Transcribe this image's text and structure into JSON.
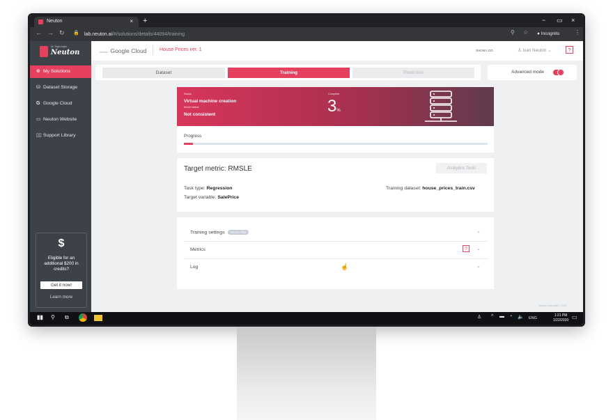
{
  "browser": {
    "tab_title": "Neuton",
    "new_tab": "+",
    "tab_close": "×",
    "url_host": "lab.neuton.ai",
    "url_path": "/#/solutions/details/44094/training",
    "profile_label": "Incognito",
    "window_controls": [
      "−",
      "▭",
      "×"
    ]
  },
  "sidebar": {
    "logo_text": "Neuton",
    "logo_tagline": "An Tegin Ingiin",
    "items": [
      {
        "label": "My Solutions",
        "icon": "solutions-icon",
        "active": true
      },
      {
        "label": "Dataset Storage",
        "icon": "storage-icon",
        "active": false
      },
      {
        "label": "Google Cloud",
        "icon": "google-icon",
        "active": false
      },
      {
        "label": "Neuton Website",
        "icon": "monitor-icon",
        "active": false
      },
      {
        "label": "Support Library",
        "icon": "book-icon",
        "active": false
      }
    ],
    "promo": {
      "symbol": "$",
      "text": "Eligible for an additional $200 in credits?",
      "button": "Get it now!",
      "link": "Learn more"
    }
  },
  "header": {
    "brand_prefix": "neuron",
    "brand": "Google Cloud",
    "project": "House Prices ver. 1",
    "schedule": "SHOW LOG",
    "user": "Ivan Neuton",
    "help": "?"
  },
  "steps": [
    {
      "label": "Dataset",
      "state": "done"
    },
    {
      "label": "Training",
      "state": "active"
    },
    {
      "label": "Prediction",
      "state": "pending"
    }
  ],
  "advanced_mode": {
    "label": "Advanced mode",
    "on": true
  },
  "status": {
    "status_label": "Status",
    "status_value": "Virtual machine creation",
    "model_label": "Model status",
    "model_value": "Not consistent",
    "complete_label": "Complete",
    "complete_value": "3",
    "complete_unit": "%",
    "progress_label": "Progress",
    "progress_fraction": 0.03
  },
  "target": {
    "metric_label": "Target metric:",
    "metric_value": "RMSLE",
    "analytics_button": "Analytics Tools",
    "task_type_label": "Task type:",
    "task_type_value": "Regression",
    "target_var_label": "Target variable:",
    "target_var_value": "SalePrice",
    "dataset_label": "Training dataset:",
    "dataset_value": "house_prices_train.csv"
  },
  "settings": {
    "rows": [
      {
        "label": "Training settings",
        "badge": "Neuton flex"
      },
      {
        "label": "Metrics",
        "help": "?"
      },
      {
        "label": "Log"
      }
    ]
  },
  "footer_text": "Neuton Enterprise © 2020",
  "taskbar": {
    "lang": "ENG",
    "time": "1:21 PM",
    "date": "1/22/2020"
  },
  "colors": {
    "accent": "#e5405e",
    "sidebar": "#3d4248",
    "taskbar": "#101114"
  }
}
